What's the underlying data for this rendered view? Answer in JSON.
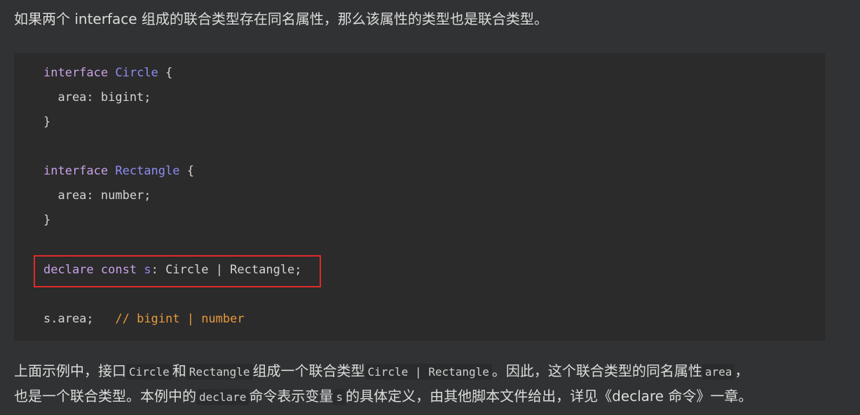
{
  "intro": {
    "text": "如果两个 interface 组成的联合类型存在同名属性，那么该属性的类型也是联合类型。"
  },
  "code": {
    "line1": {
      "kw": "interface",
      "name": "Circle",
      "brace": " {"
    },
    "line2": {
      "text": "  area: bigint;"
    },
    "line3": {
      "text": "}"
    },
    "line5": {
      "kw": "interface",
      "name": "Rectangle",
      "brace": " {"
    },
    "line6": {
      "text": "  area: number;"
    },
    "line7": {
      "text": "}"
    },
    "line9": {
      "kw1": "declare",
      "kw2": "const",
      "var": "s",
      "rest": ": Circle | Rectangle;"
    },
    "line11": {
      "text": "s.area;",
      "comment": "// bigint | number"
    }
  },
  "para2": {
    "l1_a": "上面示例中，接口",
    "l1_code1": "Circle",
    "l1_b": "和",
    "l1_code2": "Rectangle",
    "l1_c": "组成一个联合类型",
    "l1_code3": "Circle | Rectangle",
    "l1_d": "。因此，这个联合类型的同名属性",
    "l1_code4": "area",
    "l1_e": "，",
    "l2_a": "也是一个联合类型。本例中的",
    "l2_code1": "declare",
    "l2_b": "命令表示变量",
    "l2_code2": "s",
    "l2_c": "的具体定义，由其他脚本文件给出，详见《declare 命令》一章。"
  },
  "colors": {
    "background": "#313233",
    "code_background": "#2b2b2b",
    "keyword": "#c8a2e8",
    "type_name": "#8f8cf2",
    "comment": "#e89a3d",
    "highlight_border": "#e02a2a"
  }
}
